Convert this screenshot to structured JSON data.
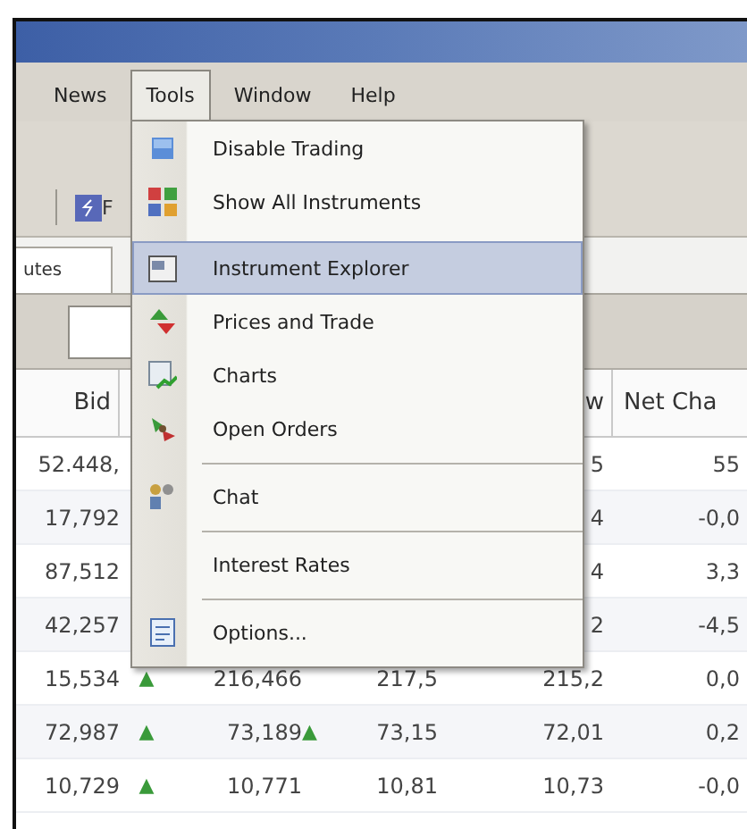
{
  "menu_bar": [
    {
      "label": "News",
      "selected": false
    },
    {
      "label": "Tools",
      "selected": true
    },
    {
      "label": "Window",
      "selected": false
    },
    {
      "label": "Help",
      "selected": false
    }
  ],
  "toolbar": {
    "label": "F"
  },
  "tabs": [
    {
      "label": "utes",
      "selected": true
    }
  ],
  "table": {
    "headers": {
      "bid": "Bid",
      "column_5": "w",
      "column_6": "Net Cha"
    },
    "rows": [
      {
        "bid": "52.448,",
        "column_5": "5",
        "column_6": "55"
      },
      {
        "bid": "17,792",
        "column_5": "4",
        "column_6": "-0,0"
      },
      {
        "bid": "87,512",
        "column_5": "4",
        "column_6": "3,3"
      },
      {
        "bid": "42,257",
        "column_5": "2",
        "column_6": "-4,5"
      },
      {
        "bid": "15,534",
        "bid_trend": "▲",
        "column_3": "216,466",
        "column_4": "217,5",
        "column_5": "215,2",
        "column_6": "0,0"
      },
      {
        "bid": "72,987",
        "bid_trend": "▲",
        "column_3": "73,189",
        "column_4_trend": "▲",
        "column_4": "73,15",
        "column_5": "72,01",
        "column_6": "0,2"
      },
      {
        "bid": "10,729",
        "bid_trend": "▲",
        "column_3": "10,771",
        "column_4": "10,81",
        "column_5": "10,73",
        "column_6": "-0,0"
      }
    ]
  },
  "tools_menu": {
    "items": [
      {
        "kind": "item",
        "label": "Disable Trading",
        "selected": false
      },
      {
        "kind": "item",
        "label": "Show All Instruments",
        "selected": false
      },
      {
        "kind": "item",
        "label": "Instrument Explorer",
        "selected": true
      },
      {
        "kind": "item",
        "label": "Prices and Trade",
        "selected": false
      },
      {
        "kind": "item",
        "label": "Charts",
        "selected": false
      },
      {
        "kind": "item",
        "label": "Open Orders",
        "selected": false
      },
      {
        "kind": "separator"
      },
      {
        "kind": "item",
        "label": "Chat",
        "selected": false
      },
      {
        "kind": "separator"
      },
      {
        "kind": "item",
        "label": "Interest Rates",
        "selected": false
      },
      {
        "kind": "separator"
      },
      {
        "kind": "item",
        "label": "Options...",
        "selected": false
      }
    ]
  }
}
